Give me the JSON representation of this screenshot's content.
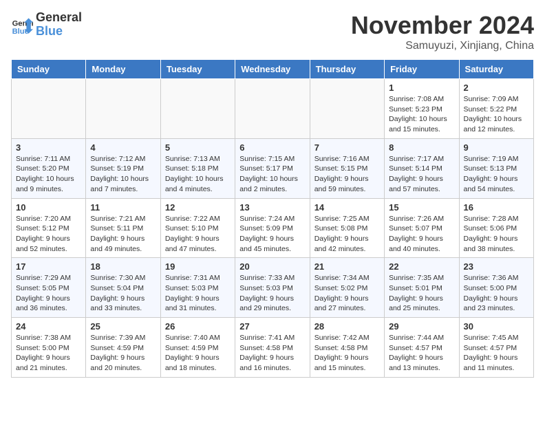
{
  "header": {
    "logo_line1": "General",
    "logo_line2": "Blue",
    "month": "November 2024",
    "location": "Samuyuzi, Xinjiang, China"
  },
  "weekdays": [
    "Sunday",
    "Monday",
    "Tuesday",
    "Wednesday",
    "Thursday",
    "Friday",
    "Saturday"
  ],
  "weeks": [
    [
      {
        "day": "",
        "info": ""
      },
      {
        "day": "",
        "info": ""
      },
      {
        "day": "",
        "info": ""
      },
      {
        "day": "",
        "info": ""
      },
      {
        "day": "",
        "info": ""
      },
      {
        "day": "1",
        "info": "Sunrise: 7:08 AM\nSunset: 5:23 PM\nDaylight: 10 hours and 15 minutes."
      },
      {
        "day": "2",
        "info": "Sunrise: 7:09 AM\nSunset: 5:22 PM\nDaylight: 10 hours and 12 minutes."
      }
    ],
    [
      {
        "day": "3",
        "info": "Sunrise: 7:11 AM\nSunset: 5:20 PM\nDaylight: 10 hours and 9 minutes."
      },
      {
        "day": "4",
        "info": "Sunrise: 7:12 AM\nSunset: 5:19 PM\nDaylight: 10 hours and 7 minutes."
      },
      {
        "day": "5",
        "info": "Sunrise: 7:13 AM\nSunset: 5:18 PM\nDaylight: 10 hours and 4 minutes."
      },
      {
        "day": "6",
        "info": "Sunrise: 7:15 AM\nSunset: 5:17 PM\nDaylight: 10 hours and 2 minutes."
      },
      {
        "day": "7",
        "info": "Sunrise: 7:16 AM\nSunset: 5:15 PM\nDaylight: 9 hours and 59 minutes."
      },
      {
        "day": "8",
        "info": "Sunrise: 7:17 AM\nSunset: 5:14 PM\nDaylight: 9 hours and 57 minutes."
      },
      {
        "day": "9",
        "info": "Sunrise: 7:19 AM\nSunset: 5:13 PM\nDaylight: 9 hours and 54 minutes."
      }
    ],
    [
      {
        "day": "10",
        "info": "Sunrise: 7:20 AM\nSunset: 5:12 PM\nDaylight: 9 hours and 52 minutes."
      },
      {
        "day": "11",
        "info": "Sunrise: 7:21 AM\nSunset: 5:11 PM\nDaylight: 9 hours and 49 minutes."
      },
      {
        "day": "12",
        "info": "Sunrise: 7:22 AM\nSunset: 5:10 PM\nDaylight: 9 hours and 47 minutes."
      },
      {
        "day": "13",
        "info": "Sunrise: 7:24 AM\nSunset: 5:09 PM\nDaylight: 9 hours and 45 minutes."
      },
      {
        "day": "14",
        "info": "Sunrise: 7:25 AM\nSunset: 5:08 PM\nDaylight: 9 hours and 42 minutes."
      },
      {
        "day": "15",
        "info": "Sunrise: 7:26 AM\nSunset: 5:07 PM\nDaylight: 9 hours and 40 minutes."
      },
      {
        "day": "16",
        "info": "Sunrise: 7:28 AM\nSunset: 5:06 PM\nDaylight: 9 hours and 38 minutes."
      }
    ],
    [
      {
        "day": "17",
        "info": "Sunrise: 7:29 AM\nSunset: 5:05 PM\nDaylight: 9 hours and 36 minutes."
      },
      {
        "day": "18",
        "info": "Sunrise: 7:30 AM\nSunset: 5:04 PM\nDaylight: 9 hours and 33 minutes."
      },
      {
        "day": "19",
        "info": "Sunrise: 7:31 AM\nSunset: 5:03 PM\nDaylight: 9 hours and 31 minutes."
      },
      {
        "day": "20",
        "info": "Sunrise: 7:33 AM\nSunset: 5:03 PM\nDaylight: 9 hours and 29 minutes."
      },
      {
        "day": "21",
        "info": "Sunrise: 7:34 AM\nSunset: 5:02 PM\nDaylight: 9 hours and 27 minutes."
      },
      {
        "day": "22",
        "info": "Sunrise: 7:35 AM\nSunset: 5:01 PM\nDaylight: 9 hours and 25 minutes."
      },
      {
        "day": "23",
        "info": "Sunrise: 7:36 AM\nSunset: 5:00 PM\nDaylight: 9 hours and 23 minutes."
      }
    ],
    [
      {
        "day": "24",
        "info": "Sunrise: 7:38 AM\nSunset: 5:00 PM\nDaylight: 9 hours and 21 minutes."
      },
      {
        "day": "25",
        "info": "Sunrise: 7:39 AM\nSunset: 4:59 PM\nDaylight: 9 hours and 20 minutes."
      },
      {
        "day": "26",
        "info": "Sunrise: 7:40 AM\nSunset: 4:59 PM\nDaylight: 9 hours and 18 minutes."
      },
      {
        "day": "27",
        "info": "Sunrise: 7:41 AM\nSunset: 4:58 PM\nDaylight: 9 hours and 16 minutes."
      },
      {
        "day": "28",
        "info": "Sunrise: 7:42 AM\nSunset: 4:58 PM\nDaylight: 9 hours and 15 minutes."
      },
      {
        "day": "29",
        "info": "Sunrise: 7:44 AM\nSunset: 4:57 PM\nDaylight: 9 hours and 13 minutes."
      },
      {
        "day": "30",
        "info": "Sunrise: 7:45 AM\nSunset: 4:57 PM\nDaylight: 9 hours and 11 minutes."
      }
    ]
  ]
}
